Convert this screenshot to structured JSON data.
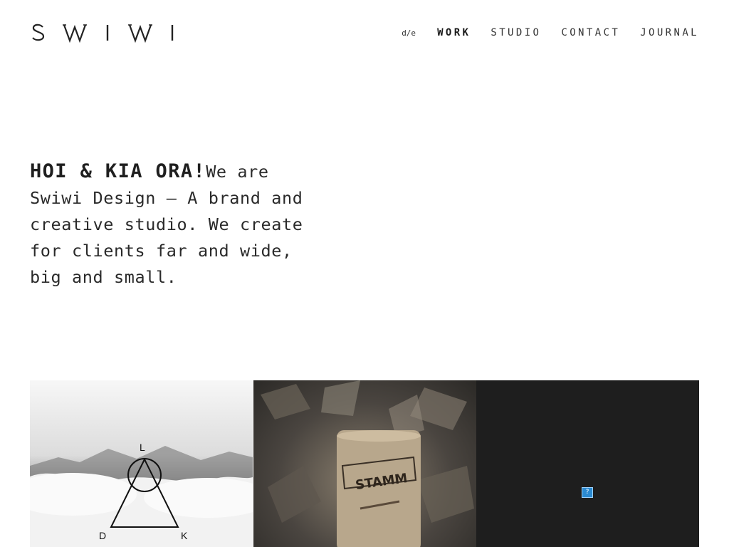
{
  "brand": {
    "logo_text": "SWIWI"
  },
  "nav": {
    "lang_label": "d/e",
    "items": [
      {
        "label": "WORK",
        "active": true
      },
      {
        "label": "STUDIO",
        "active": false
      },
      {
        "label": "CONTACT",
        "active": false
      },
      {
        "label": "JOURNAL",
        "active": false
      }
    ]
  },
  "hero": {
    "greeting": "HOI & KIA ORA!",
    "text": "We are Swiwi Design – A brand and creative studio. We create for clients far and wide, big and small."
  },
  "projects": [
    {
      "name": "mountain-logo",
      "letters": [
        "L",
        "D",
        "K"
      ]
    },
    {
      "name": "cork-stamm",
      "cork_text": "STAMM"
    },
    {
      "name": "broken-image",
      "glyph": "?"
    }
  ],
  "colors": {
    "text": "#222222",
    "background": "#ffffff",
    "dark_tile": "#1e1e1e"
  }
}
